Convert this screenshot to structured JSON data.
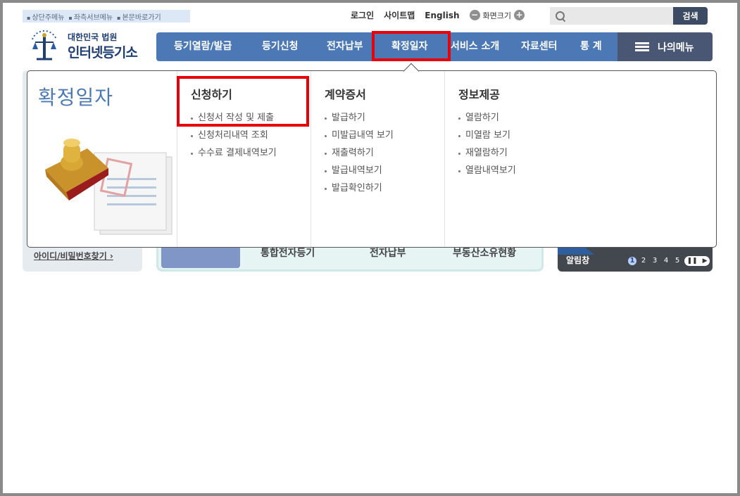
{
  "skip_links": [
    "상단주메뉴",
    "좌측서브메뉴",
    "본문바로가기"
  ],
  "util": {
    "login": "로그인",
    "sitemap": "사이트맵",
    "english": "English",
    "font_size": "화면크기",
    "minus": "−",
    "plus": "+"
  },
  "search": {
    "placeholder": "",
    "button": "검색"
  },
  "logo": {
    "sub": "대한민국 법원",
    "main": "인터넷등기소"
  },
  "gnb": {
    "items": [
      "등기열람/발급",
      "등기신청",
      "전자납부",
      "확정일자",
      "서비스 소개",
      "자료센터",
      "통 계"
    ],
    "my_menu": "나의메뉴",
    "active_index": 3
  },
  "panel": {
    "title": "확정일자",
    "columns": [
      {
        "heading": "신청하기",
        "items": [
          "신청서 작성 및 제출",
          "신청처리내역 조회",
          "수수료 결제내역보기"
        ]
      },
      {
        "heading": "계약증서",
        "items": [
          "발급하기",
          "미발급내역 보기",
          "재출력하기",
          "발급내역보기",
          "발급확인하기"
        ]
      },
      {
        "heading": "정보제공",
        "items": [
          "열람하기",
          "미열람 보기",
          "재열람하기",
          "열람내역보기"
        ]
      }
    ]
  },
  "background": {
    "find_account": "아이디/비밀번호찾기 ›",
    "mid_items": [
      "통합전자등기",
      "전자납부",
      "부동산소유현황"
    ],
    "notice_label": "알림창",
    "pager": [
      "1",
      "2",
      "3",
      "4",
      "5"
    ],
    "pager_active": "1"
  },
  "colors": {
    "nav_blue": "#4c79b5",
    "my_menu": "#4a5774",
    "highlight_red": "#e8000b",
    "title_blue": "#4c79b5"
  }
}
